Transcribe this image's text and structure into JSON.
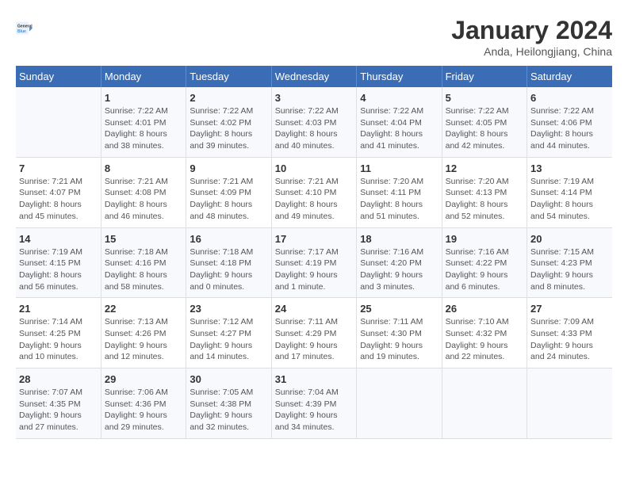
{
  "logo": {
    "line1": "General",
    "line2": "Blue"
  },
  "title": "January 2024",
  "subtitle": "Anda, Heilongjiang, China",
  "weekdays": [
    "Sunday",
    "Monday",
    "Tuesday",
    "Wednesday",
    "Thursday",
    "Friday",
    "Saturday"
  ],
  "weeks": [
    [
      {
        "day": "",
        "info": ""
      },
      {
        "day": "1",
        "info": "Sunrise: 7:22 AM\nSunset: 4:01 PM\nDaylight: 8 hours\nand 38 minutes."
      },
      {
        "day": "2",
        "info": "Sunrise: 7:22 AM\nSunset: 4:02 PM\nDaylight: 8 hours\nand 39 minutes."
      },
      {
        "day": "3",
        "info": "Sunrise: 7:22 AM\nSunset: 4:03 PM\nDaylight: 8 hours\nand 40 minutes."
      },
      {
        "day": "4",
        "info": "Sunrise: 7:22 AM\nSunset: 4:04 PM\nDaylight: 8 hours\nand 41 minutes."
      },
      {
        "day": "5",
        "info": "Sunrise: 7:22 AM\nSunset: 4:05 PM\nDaylight: 8 hours\nand 42 minutes."
      },
      {
        "day": "6",
        "info": "Sunrise: 7:22 AM\nSunset: 4:06 PM\nDaylight: 8 hours\nand 44 minutes."
      }
    ],
    [
      {
        "day": "7",
        "info": "Sunrise: 7:21 AM\nSunset: 4:07 PM\nDaylight: 8 hours\nand 45 minutes."
      },
      {
        "day": "8",
        "info": "Sunrise: 7:21 AM\nSunset: 4:08 PM\nDaylight: 8 hours\nand 46 minutes."
      },
      {
        "day": "9",
        "info": "Sunrise: 7:21 AM\nSunset: 4:09 PM\nDaylight: 8 hours\nand 48 minutes."
      },
      {
        "day": "10",
        "info": "Sunrise: 7:21 AM\nSunset: 4:10 PM\nDaylight: 8 hours\nand 49 minutes."
      },
      {
        "day": "11",
        "info": "Sunrise: 7:20 AM\nSunset: 4:11 PM\nDaylight: 8 hours\nand 51 minutes."
      },
      {
        "day": "12",
        "info": "Sunrise: 7:20 AM\nSunset: 4:13 PM\nDaylight: 8 hours\nand 52 minutes."
      },
      {
        "day": "13",
        "info": "Sunrise: 7:19 AM\nSunset: 4:14 PM\nDaylight: 8 hours\nand 54 minutes."
      }
    ],
    [
      {
        "day": "14",
        "info": "Sunrise: 7:19 AM\nSunset: 4:15 PM\nDaylight: 8 hours\nand 56 minutes."
      },
      {
        "day": "15",
        "info": "Sunrise: 7:18 AM\nSunset: 4:16 PM\nDaylight: 8 hours\nand 58 minutes."
      },
      {
        "day": "16",
        "info": "Sunrise: 7:18 AM\nSunset: 4:18 PM\nDaylight: 9 hours\nand 0 minutes."
      },
      {
        "day": "17",
        "info": "Sunrise: 7:17 AM\nSunset: 4:19 PM\nDaylight: 9 hours\nand 1 minute."
      },
      {
        "day": "18",
        "info": "Sunrise: 7:16 AM\nSunset: 4:20 PM\nDaylight: 9 hours\nand 3 minutes."
      },
      {
        "day": "19",
        "info": "Sunrise: 7:16 AM\nSunset: 4:22 PM\nDaylight: 9 hours\nand 6 minutes."
      },
      {
        "day": "20",
        "info": "Sunrise: 7:15 AM\nSunset: 4:23 PM\nDaylight: 9 hours\nand 8 minutes."
      }
    ],
    [
      {
        "day": "21",
        "info": "Sunrise: 7:14 AM\nSunset: 4:25 PM\nDaylight: 9 hours\nand 10 minutes."
      },
      {
        "day": "22",
        "info": "Sunrise: 7:13 AM\nSunset: 4:26 PM\nDaylight: 9 hours\nand 12 minutes."
      },
      {
        "day": "23",
        "info": "Sunrise: 7:12 AM\nSunset: 4:27 PM\nDaylight: 9 hours\nand 14 minutes."
      },
      {
        "day": "24",
        "info": "Sunrise: 7:11 AM\nSunset: 4:29 PM\nDaylight: 9 hours\nand 17 minutes."
      },
      {
        "day": "25",
        "info": "Sunrise: 7:11 AM\nSunset: 4:30 PM\nDaylight: 9 hours\nand 19 minutes."
      },
      {
        "day": "26",
        "info": "Sunrise: 7:10 AM\nSunset: 4:32 PM\nDaylight: 9 hours\nand 22 minutes."
      },
      {
        "day": "27",
        "info": "Sunrise: 7:09 AM\nSunset: 4:33 PM\nDaylight: 9 hours\nand 24 minutes."
      }
    ],
    [
      {
        "day": "28",
        "info": "Sunrise: 7:07 AM\nSunset: 4:35 PM\nDaylight: 9 hours\nand 27 minutes."
      },
      {
        "day": "29",
        "info": "Sunrise: 7:06 AM\nSunset: 4:36 PM\nDaylight: 9 hours\nand 29 minutes."
      },
      {
        "day": "30",
        "info": "Sunrise: 7:05 AM\nSunset: 4:38 PM\nDaylight: 9 hours\nand 32 minutes."
      },
      {
        "day": "31",
        "info": "Sunrise: 7:04 AM\nSunset: 4:39 PM\nDaylight: 9 hours\nand 34 minutes."
      },
      {
        "day": "",
        "info": ""
      },
      {
        "day": "",
        "info": ""
      },
      {
        "day": "",
        "info": ""
      }
    ]
  ]
}
